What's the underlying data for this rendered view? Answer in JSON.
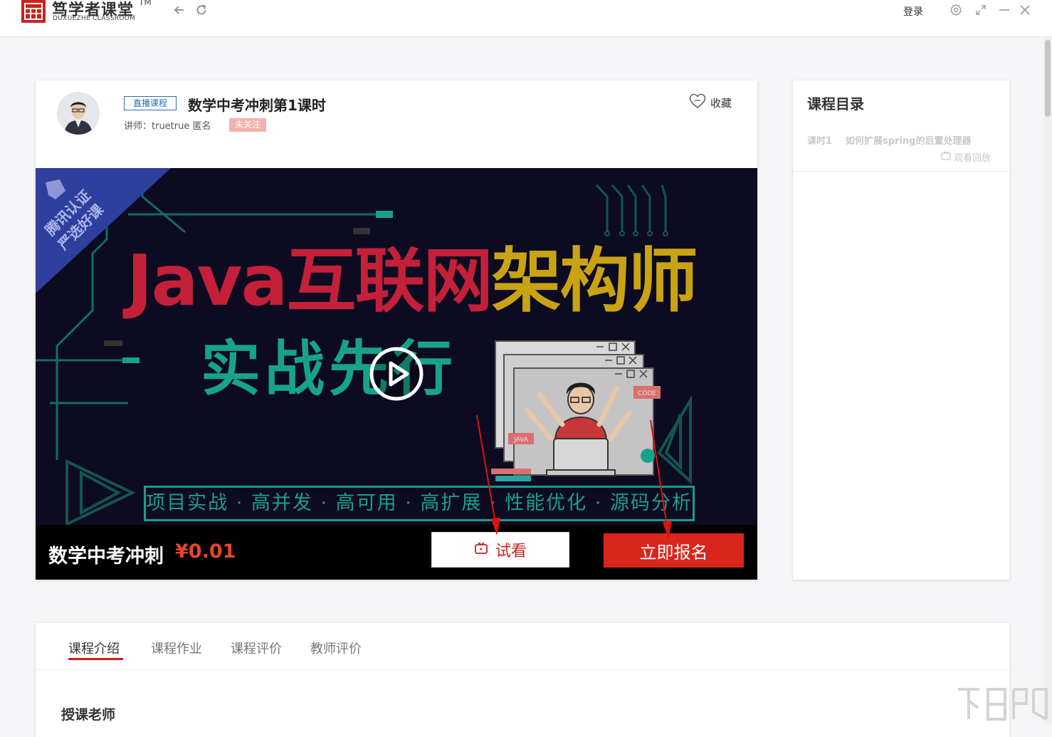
{
  "app": {
    "logo_name": "笃学者课堂",
    "logo_tm": "TM",
    "logo_sub": "DUXUEZHE CLASSROOM",
    "login_label": "登录",
    "brand_color": "#c8231c"
  },
  "course": {
    "tag": "直播课程",
    "title": "数学中考冲刺第1课时",
    "teacher": "讲师：truetrue 匿名",
    "follow_status": "未关注",
    "favorite_label": "收藏"
  },
  "banner": {
    "badge_line1": "腾讯认证",
    "badge_line2": "严选好课",
    "headline_red": "Java互联网",
    "headline_gold": "架构师",
    "subhead": "实战先行",
    "features": "项目实战 · 高并发 · 高可用 · 高扩展 · 性能优化 · 源码分析",
    "code_label": "CODE",
    "java_label": "JAVA"
  },
  "purchase": {
    "name": "数学中考冲刺",
    "price": "¥0.01",
    "trial_label": "试看",
    "enroll_label": "立即报名"
  },
  "catalog": {
    "title": "课程目录",
    "lessons": [
      {
        "number": "课时1",
        "name": "如何扩展spring的后置处理器",
        "replay_label": "观看回放"
      }
    ]
  },
  "tabs": [
    {
      "label": "课程介绍",
      "active": true
    },
    {
      "label": "课程作业",
      "active": false
    },
    {
      "label": "课程评价",
      "active": false
    },
    {
      "label": "教师评价",
      "active": false
    }
  ],
  "section": {
    "title": "授课老师"
  }
}
